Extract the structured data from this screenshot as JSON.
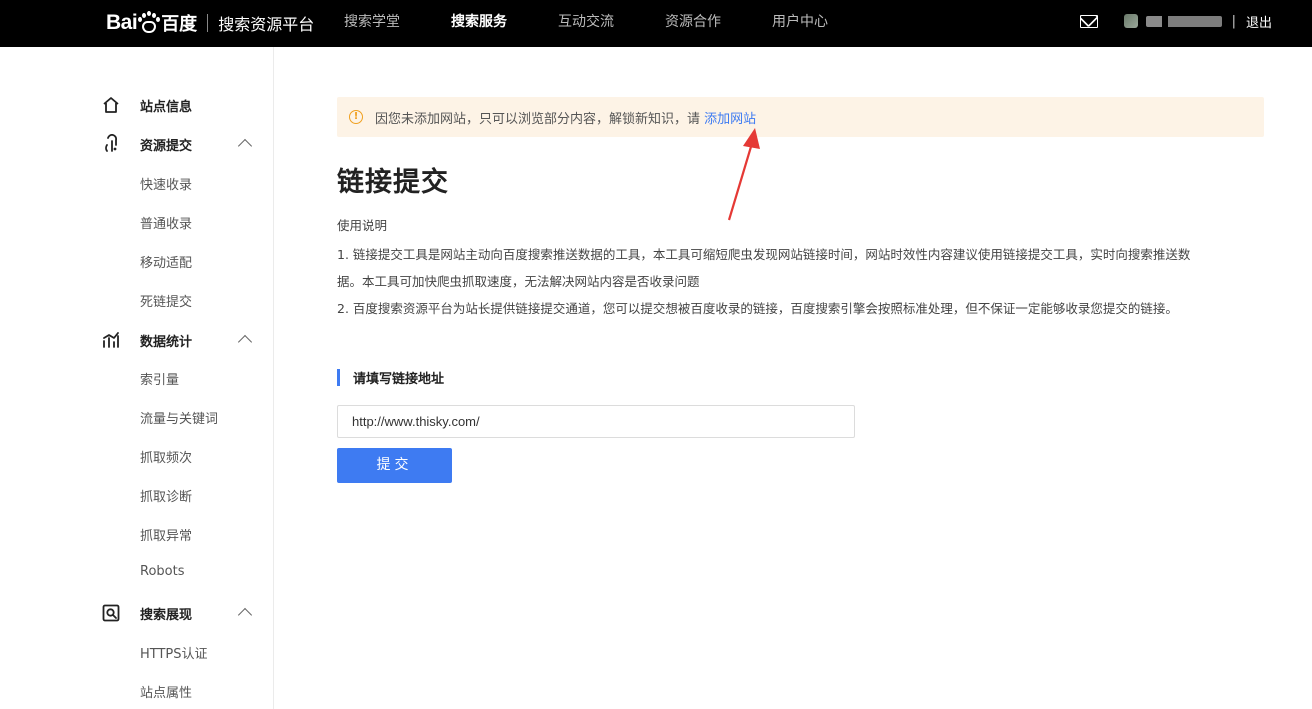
{
  "header": {
    "logo_bai": "Bai",
    "logo_cn": "百度",
    "platform": "搜索资源平台",
    "nav": [
      {
        "label": "搜索学堂",
        "active": false
      },
      {
        "label": "搜索服务",
        "active": true
      },
      {
        "label": "互动交流",
        "active": false
      },
      {
        "label": "资源合作",
        "active": false
      },
      {
        "label": "用户中心",
        "active": false
      }
    ],
    "separator": "|",
    "logout": "退出"
  },
  "sidebar": {
    "groups": [
      {
        "label": "站点信息",
        "icon": "home-icon",
        "items": []
      },
      {
        "label": "资源提交",
        "icon": "submit-icon",
        "items": [
          "快速收录",
          "普通收录",
          "移动适配",
          "死链提交"
        ]
      },
      {
        "label": "数据统计",
        "icon": "stats-icon",
        "items": [
          "索引量",
          "流量与关键词",
          "抓取频次",
          "抓取诊断",
          "抓取异常",
          "Robots"
        ]
      },
      {
        "label": "搜索展现",
        "icon": "search-display-icon",
        "items": [
          "HTTPS认证",
          "站点属性"
        ]
      }
    ]
  },
  "notice": {
    "icon": "warning-icon",
    "text": "因您未添加网站，只可以浏览部分内容，解锁新知识，请 ",
    "link": "添加网站",
    "color": "#fdf3e6"
  },
  "main": {
    "title": "链接提交",
    "usage_title": "使用说明",
    "para1_line1": "1. 链接提交工具是网站主动向百度搜索推送数据的工具，本工具可缩短爬虫发现网站链接时间，网站时效性内容建议使用链接提交工具，实时向搜索推送数",
    "para1_line2": "据。本工具可加快爬虫抓取速度，无法解决网站内容是否收录问题",
    "para2": "2. 百度搜索资源平台为站长提供链接提交通道，您可以提交想被百度收录的链接，百度搜索引擎会按照标准处理，但不保证一定能够收录您提交的链接。",
    "section_title": "请填写链接地址",
    "input_value": "http://www.thisky.com/",
    "submit_label": "提交",
    "accent": "#3e7bf2"
  }
}
